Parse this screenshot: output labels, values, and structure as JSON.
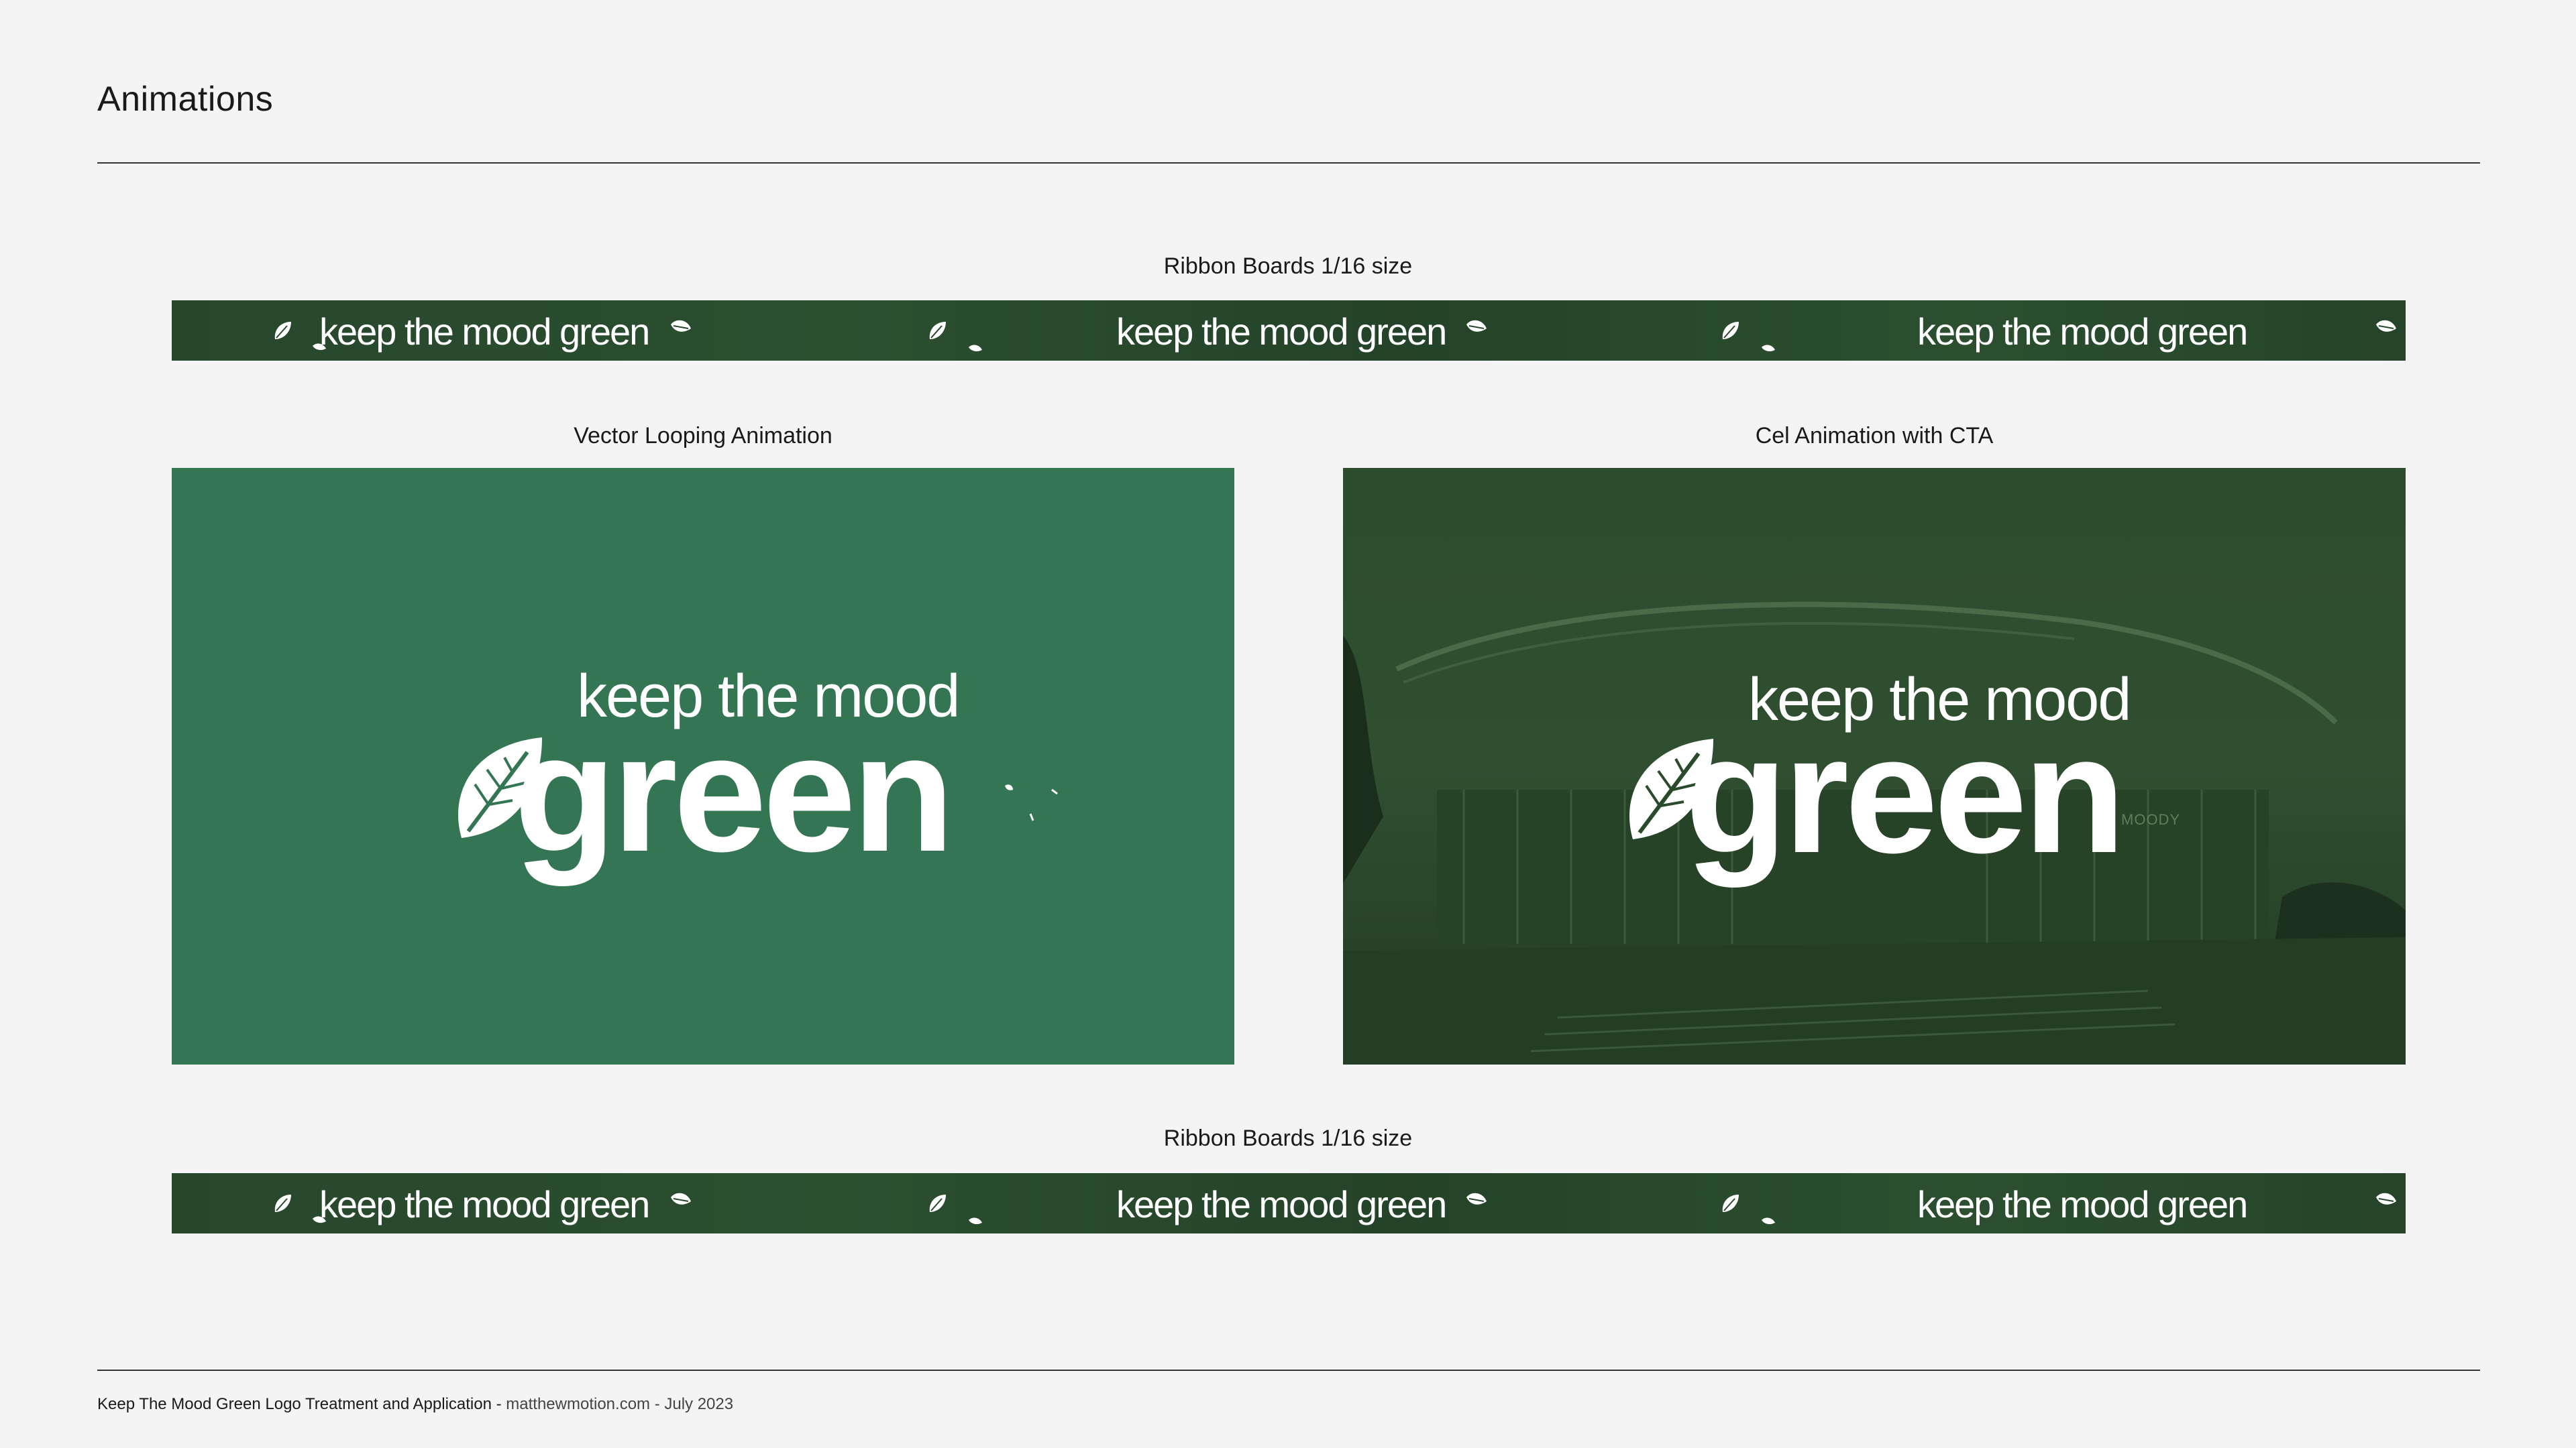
{
  "page": {
    "title": "Animations"
  },
  "ribbons": {
    "top_caption": "Ribbon Boards 1/16 size",
    "bottom_caption": "Ribbon Boards 1/16 size",
    "phrase": "keep the mood green"
  },
  "panels": {
    "left": {
      "caption": "Vector Looping Animation",
      "logo_top": "keep the mood",
      "logo_main": "green"
    },
    "right": {
      "caption": "Cel Animation with CTA",
      "logo_top": "keep the mood",
      "logo_main": "green",
      "sign_text": "MOODY"
    }
  },
  "footer": {
    "title": "Keep The Mood Green Logo Treatment and Application - ",
    "credit": "matthewmotion.com - July 2023"
  },
  "colors": {
    "background": "#f4f4f4",
    "ribbon_green": "#27472c",
    "vector_green": "#347653",
    "photo_green": "#2a4a2c",
    "logo_white": "#ffffff"
  }
}
